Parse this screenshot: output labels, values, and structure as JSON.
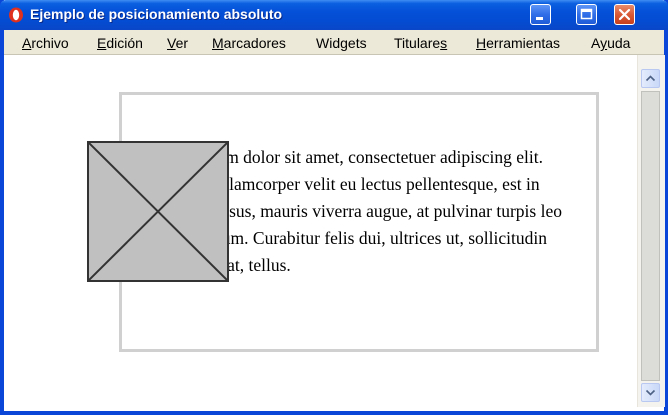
{
  "window": {
    "title": "Ejemplo de posicionamiento absoluto",
    "accent_color": "#0a46d8",
    "controls": [
      "minimize-icon",
      "maximize-icon",
      "close-icon"
    ]
  },
  "menubar": {
    "items": [
      {
        "pre": "",
        "u": "A",
        "post": "rchivo"
      },
      {
        "pre": "",
        "u": "E",
        "post": "dición"
      },
      {
        "pre": "",
        "u": "V",
        "post": "er"
      },
      {
        "pre": "",
        "u": "M",
        "post": "arcadores"
      },
      {
        "pre": "Wid",
        "u": "g",
        "post": "ets"
      },
      {
        "pre": "Titulare",
        "u": "s",
        "post": ""
      },
      {
        "pre": "",
        "u": "H",
        "post": "erramientas"
      },
      {
        "pre": "A",
        "u": "y",
        "post": "uda"
      }
    ]
  },
  "content": {
    "paragraph": "Lorem ipsum dolor sit amet, consectetuer adipiscing elit. Phasellus ullamcorper velit eu lectus pellentesque, est in volutpat cursus, mauris viverra augue, at pulvinar turpis leo sed nec ipsum. Curabitur felis dui, ultrices ut, sollicitudin vel, rutrum at, tellus.",
    "image_icon": "placeholder-image-icon"
  }
}
